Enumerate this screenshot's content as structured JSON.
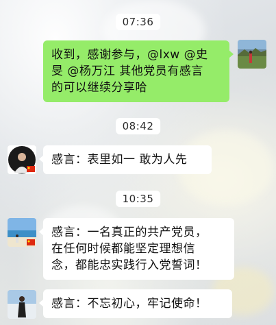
{
  "messages": [
    {
      "time": "07:36",
      "sender": "me",
      "lines": [
        "收到，感谢参与，@lxw @史",
        "旻 @杨万江 其他党员有感言",
        "的可以继续分享哈"
      ]
    },
    {
      "time": "08:42",
      "sender": "other",
      "lines": [
        "感言：表里如一 敢为人先"
      ]
    },
    {
      "time": "10:35",
      "sender": "other",
      "lines": [
        "感言：一名真正的共产党员，",
        "在任何时候都能坚定理想信",
        "念，都能忠实践行入党誓词！"
      ]
    },
    {
      "time": "",
      "sender": "other",
      "lines": [
        "感言：不忘初心，牢记使命！"
      ]
    }
  ],
  "avatars": {
    "me": "landscape-avatar",
    "user_a": "person-flag-avatar",
    "user_b": "beach-flag-avatar",
    "user_c": "person-landscape-avatar"
  },
  "colors": {
    "my_bubble": "#95ec69",
    "other_bubble": "#ffffff",
    "time_pill": "#ffffff",
    "flag_red": "#de2910",
    "flag_yellow": "#ffde00"
  }
}
